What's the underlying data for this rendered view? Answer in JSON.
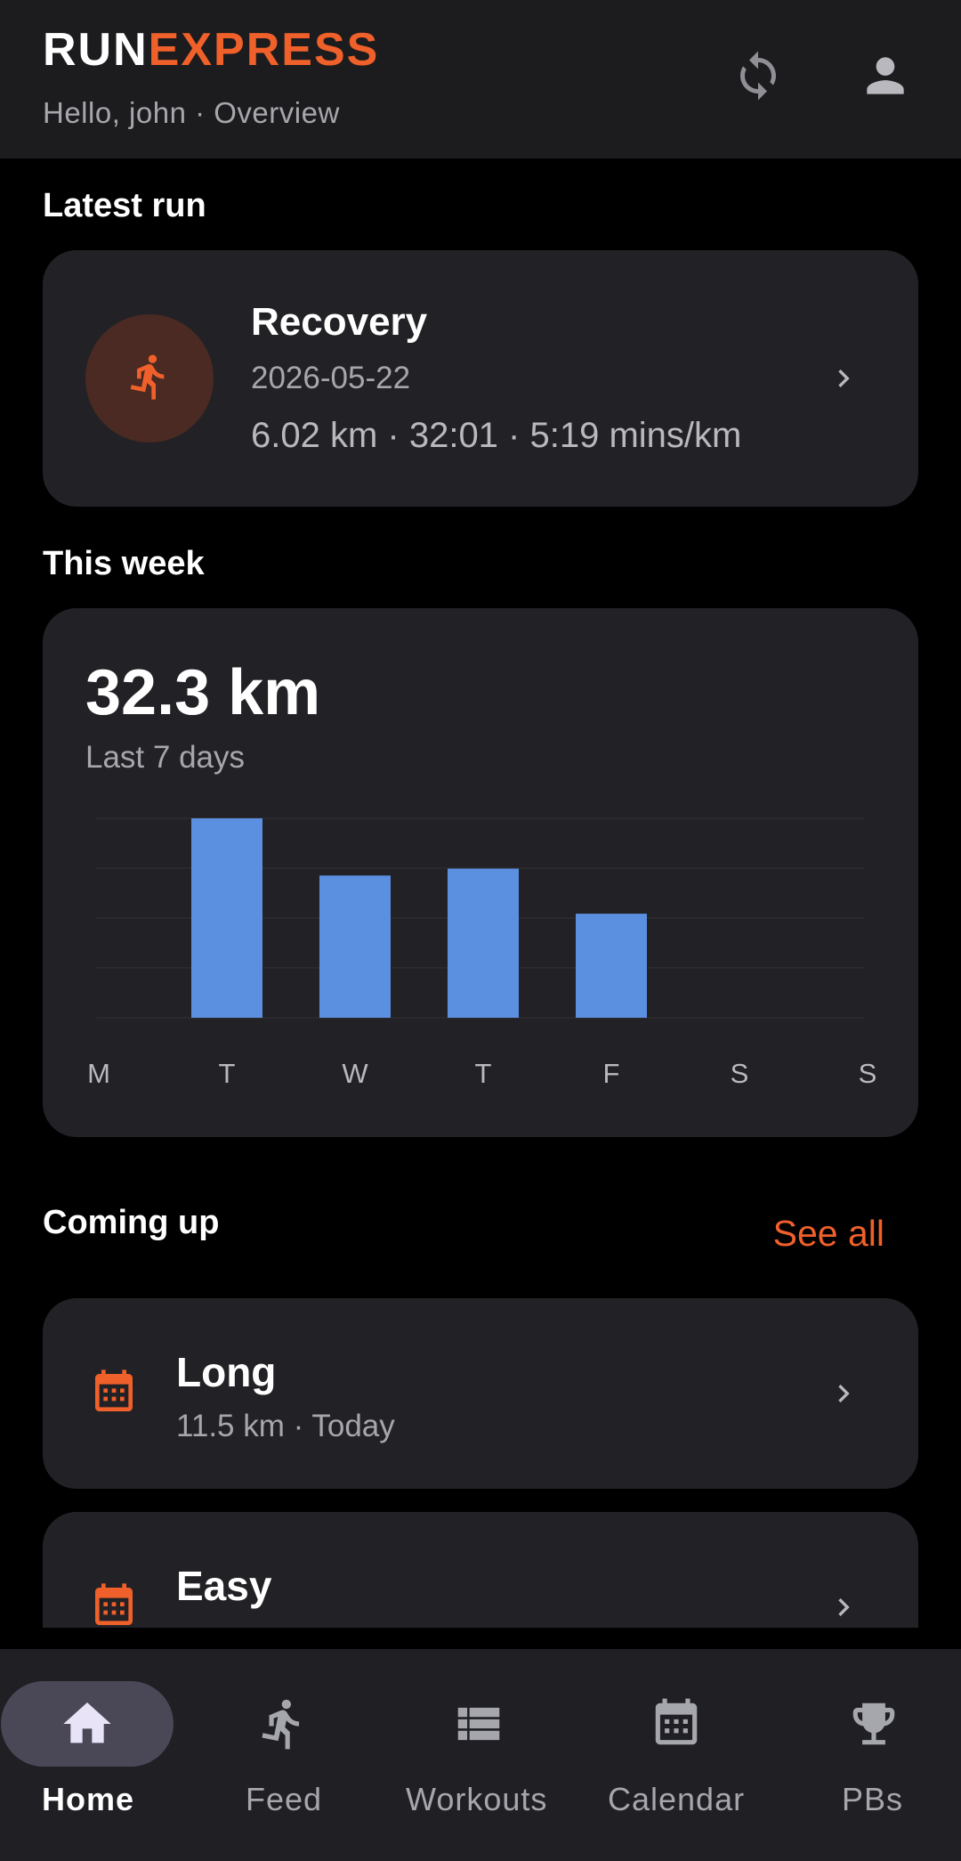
{
  "app": {
    "logo_part1": "RUN",
    "logo_part2": "EXPRESS",
    "greeting": "Hello, john · Overview",
    "accent_color": "#f0602a"
  },
  "header_icons": [
    "sync-icon",
    "account-icon"
  ],
  "latest_run": {
    "section_title": "Latest run",
    "title": "Recovery",
    "date": "2026-05-22",
    "stats": "6.02 km · 32:01 · 5:19 mins/km",
    "icon": "runner-icon"
  },
  "this_week": {
    "section_title": "This week",
    "total": "32.3 km",
    "subtitle": "Last 7 days"
  },
  "chart_data": {
    "type": "bar",
    "categories": [
      "M",
      "T",
      "W",
      "T",
      "F",
      "S",
      "S"
    ],
    "values": [
      0,
      11.5,
      8.2,
      8.6,
      6.0,
      0,
      0
    ],
    "ylim": [
      0,
      11.5
    ],
    "grid": true,
    "bar_color": "#5b8fe0"
  },
  "coming_up": {
    "section_title": "Coming up",
    "see_all": "See all",
    "items": [
      {
        "title": "Long",
        "subtitle": "11.5 km · Today",
        "icon": "calendar-icon"
      },
      {
        "title": "Easy",
        "subtitle": "",
        "icon": "calendar-icon"
      }
    ]
  },
  "nav": {
    "items": [
      {
        "label": "Home",
        "icon": "home-icon",
        "active": true
      },
      {
        "label": "Feed",
        "icon": "runner-icon",
        "active": false
      },
      {
        "label": "Workouts",
        "icon": "list-icon",
        "active": false
      },
      {
        "label": "Calendar",
        "icon": "calendar-icon",
        "active": false
      },
      {
        "label": "PBs",
        "icon": "trophy-icon",
        "active": false
      }
    ]
  }
}
